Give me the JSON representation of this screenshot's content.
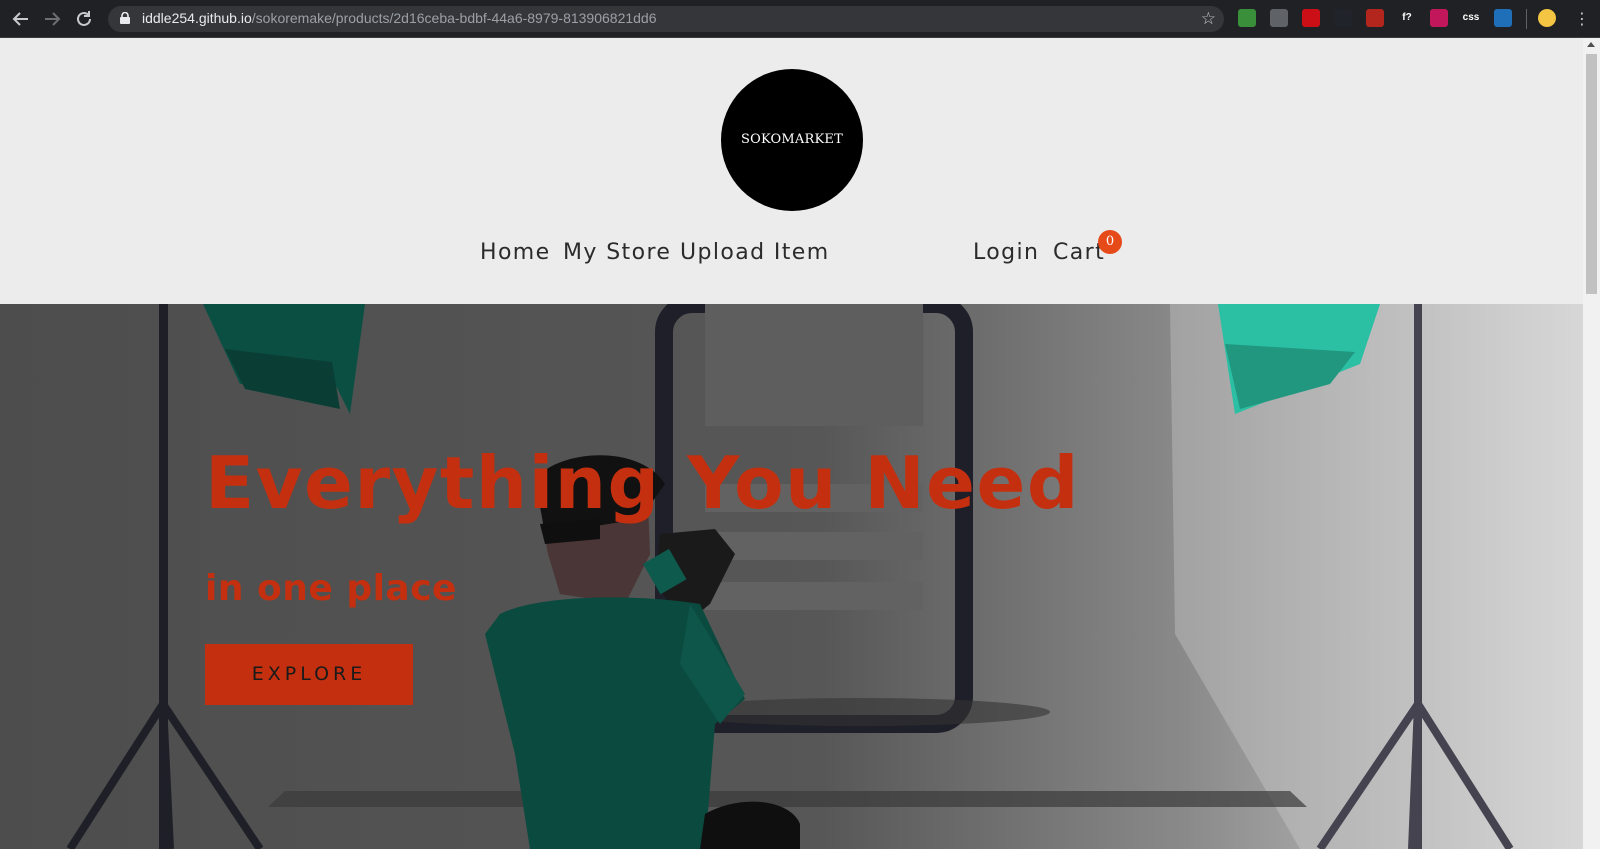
{
  "browser": {
    "url_host": "iddle254.github.io",
    "url_path": "/sokoremake/products/2d16ceba-bdbf-44a6-8979-813906821dd6",
    "back_icon": "arrow-left-icon",
    "forward_icon": "arrow-right-icon",
    "reload_icon": "reload-icon",
    "star_icon": "star-icon",
    "extensions": [
      {
        "name": "globe-extension-icon",
        "label": "",
        "color": "#3a8f3a"
      },
      {
        "name": "spinner-extension-icon",
        "label": "",
        "color": "#5f6368"
      },
      {
        "name": "opera-extension-icon",
        "label": "",
        "color": "#cc0f16"
      },
      {
        "name": "react-extension-icon",
        "label": "",
        "color": "#20232a"
      },
      {
        "name": "redux-extension-icon",
        "label": "",
        "color": "#b3261e"
      },
      {
        "name": "font-extension-icon",
        "label": "f?",
        "color": "#202124"
      },
      {
        "name": "pink-extension-icon",
        "label": "",
        "color": "#c2185b"
      },
      {
        "name": "css-extension-icon",
        "label": "css",
        "color": "#202124"
      },
      {
        "name": "css3-extension-icon",
        "label": "",
        "color": "#1e6fb8"
      },
      {
        "name": "avatar-extension-icon",
        "label": "",
        "color": "#f4c542"
      }
    ]
  },
  "site": {
    "logo_text": "SOKOMARKET",
    "nav": {
      "home": "Home",
      "my_store": "My Store",
      "upload_item": "Upload Item",
      "login": "Login",
      "cart": "Cart",
      "cart_count": "0"
    },
    "hero": {
      "title": "Everything You Need",
      "subtitle": "in one place",
      "button": "EXPLORE"
    },
    "colors": {
      "accent": "#c4300f",
      "badge": "#e64a19",
      "header_bg": "#ececec"
    }
  }
}
